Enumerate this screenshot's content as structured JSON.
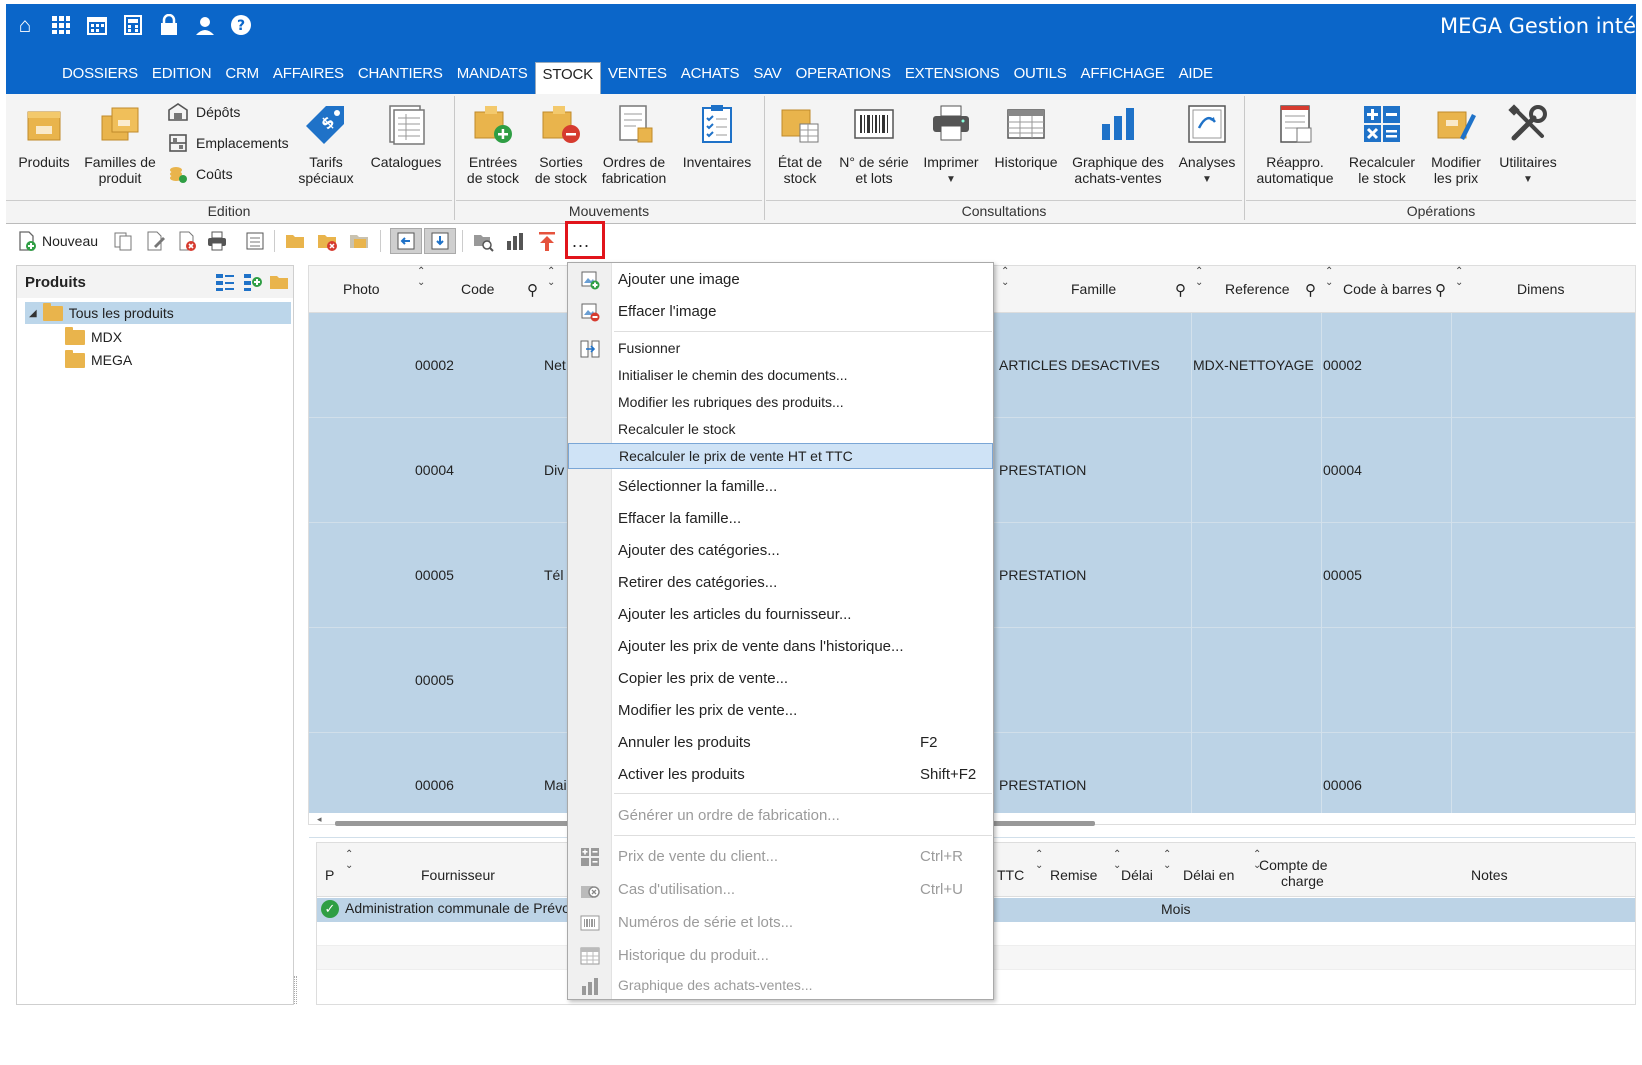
{
  "app": {
    "title": "MEGA Gestion inté"
  },
  "menubar": {
    "items": [
      "DOSSIERS",
      "EDITION",
      "CRM",
      "AFFAIRES",
      "CHANTIERS",
      "MANDATS",
      "STOCK",
      "VENTES",
      "ACHATS",
      "SAV",
      "OPERATIONS",
      "EXTENSIONS",
      "OUTILS",
      "AFFICHAGE",
      "AIDE"
    ],
    "active": "STOCK"
  },
  "ribbon": {
    "edition": {
      "label": "Edition",
      "produits": "Produits",
      "familles_l1": "Familles de",
      "familles_l2": "produit",
      "depots": "Dépôts",
      "emplacements": "Emplacements",
      "couts": "Coûts",
      "tarifs_l1": "Tarifs",
      "tarifs_l2": "spéciaux",
      "catalogues": "Catalogues"
    },
    "mouvements": {
      "label": "Mouvements",
      "entrees_l1": "Entrées",
      "entrees_l2": "de stock",
      "sorties_l1": "Sorties",
      "sorties_l2": "de stock",
      "ordres_l1": "Ordres de",
      "ordres_l2": "fabrication",
      "inventaires": "Inventaires"
    },
    "consultations": {
      "label": "Consultations",
      "etat_l1": "État de",
      "etat_l2": "stock",
      "serie_l1": "N° de série",
      "serie_l2": "et lots",
      "imprimer": "Imprimer",
      "historique": "Historique",
      "graph_l1": "Graphique des",
      "graph_l2": "achats-ventes",
      "analyses": "Analyses"
    },
    "operations": {
      "label": "Opérations",
      "reappro_l1": "Réappro.",
      "reappro_l2": "automatique",
      "recalc_l1": "Recalculer",
      "recalc_l2": "le stock",
      "modif_l1": "Modifier",
      "modif_l2": "les prix",
      "utilitaires": "Utilitaires"
    }
  },
  "toolbar": {
    "nouveau": "Nouveau",
    "more": "..."
  },
  "tree": {
    "title": "Produits",
    "root": "Tous les produits",
    "children": [
      "MDX",
      "MEGA"
    ]
  },
  "grid": {
    "headers": {
      "photo": "Photo",
      "code": "Code",
      "famille": "Famille",
      "reference": "Reference",
      "barcode": "Code à barres",
      "dimens": "Dimens"
    },
    "rows": [
      {
        "code": "00002",
        "name": "Net",
        "famille": "ARTICLES DESACTIVES",
        "reference": "MDX-NETTOYAGE",
        "barcode": "00002"
      },
      {
        "code": "00004",
        "name": "Div",
        "famille": "PRESTATION",
        "reference": "",
        "barcode": "00004"
      },
      {
        "code": "00005",
        "name": "Tél",
        "famille": "PRESTATION",
        "reference": "",
        "barcode": "00005"
      },
      {
        "code": "00005",
        "name": "",
        "famille": "",
        "reference": "",
        "barcode": ""
      },
      {
        "code": "00006",
        "name": "Mai",
        "famille": "PRESTATION",
        "reference": "",
        "barcode": "00006"
      }
    ]
  },
  "grid2": {
    "headers": {
      "p": "P",
      "fournisseur": "Fournisseur",
      "ttc": "TTC",
      "remise": "Remise",
      "delai": "Délai",
      "delai_en": "Délai en",
      "compte_l1": "Compte de",
      "compte_l2": "charge",
      "notes": "Notes"
    },
    "row": {
      "fournisseur": "Administration communale de Prévo",
      "delai_en": "Mois"
    }
  },
  "context_menu": {
    "items": [
      {
        "label": "Ajouter une image",
        "shortcut": ""
      },
      {
        "label": "Effacer l'image",
        "shortcut": ""
      },
      {
        "label": "Fusionner",
        "shortcut": ""
      },
      {
        "label": "Initialiser le chemin des documents...",
        "shortcut": ""
      },
      {
        "label": "Modifier les rubriques des produits...",
        "shortcut": ""
      },
      {
        "label": "Recalculer le stock",
        "shortcut": ""
      },
      {
        "label": "Recalculer le prix de vente HT et TTC",
        "shortcut": ""
      },
      {
        "label": "Sélectionner la famille...",
        "shortcut": ""
      },
      {
        "label": "Effacer la famille...",
        "shortcut": ""
      },
      {
        "label": "Ajouter des catégories...",
        "shortcut": ""
      },
      {
        "label": "Retirer des catégories...",
        "shortcut": ""
      },
      {
        "label": "Ajouter les articles du fournisseur...",
        "shortcut": ""
      },
      {
        "label": "Ajouter les prix de vente dans l'historique...",
        "shortcut": ""
      },
      {
        "label": "Copier les prix de vente...",
        "shortcut": ""
      },
      {
        "label": "Modifier les prix de vente...",
        "shortcut": ""
      },
      {
        "label": "Annuler les produits",
        "shortcut": "F2"
      },
      {
        "label": "Activer les produits",
        "shortcut": "Shift+F2"
      },
      {
        "label": "Générer un ordre de fabrication...",
        "shortcut": ""
      },
      {
        "label": "Prix de vente du client...",
        "shortcut": "Ctrl+R"
      },
      {
        "label": "Cas d'utilisation...",
        "shortcut": "Ctrl+U"
      },
      {
        "label": "Numéros de série et lots...",
        "shortcut": ""
      },
      {
        "label": "Historique du produit...",
        "shortcut": ""
      },
      {
        "label": "Graphique des achats-ventes...",
        "shortcut": ""
      }
    ]
  },
  "colors": {
    "accent": "#0b66c9",
    "selection": "#bcd3e6",
    "highlight_box": "#e1141b"
  }
}
